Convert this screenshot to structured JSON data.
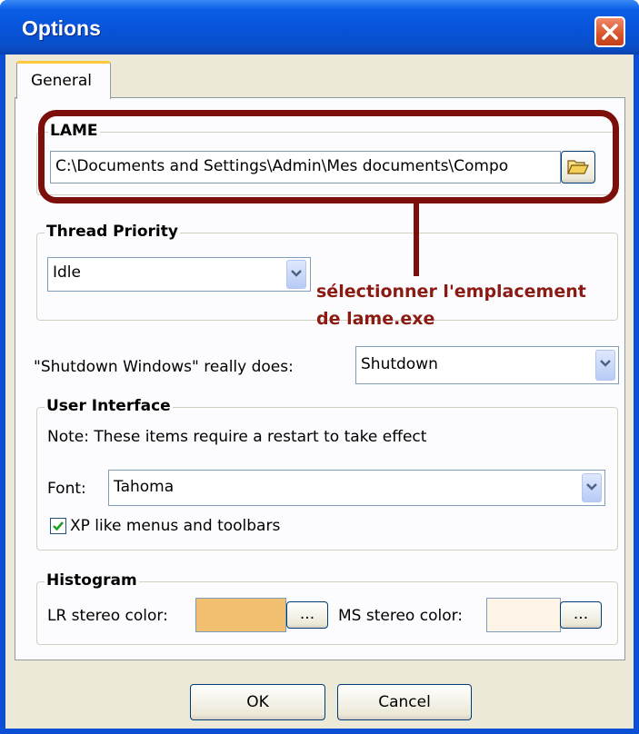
{
  "window": {
    "title": "Options"
  },
  "tabs": [
    {
      "label": "General"
    }
  ],
  "lame": {
    "group_label": "LAME",
    "path_value": "C:\\Documents and Settings\\Admin\\Mes documents\\Compo"
  },
  "thread_priority": {
    "group_label": "Thread Priority",
    "selected": "Idle"
  },
  "shutdown": {
    "label": "\"Shutdown Windows\" really does:",
    "selected": "Shutdown"
  },
  "user_interface": {
    "group_label": "User Interface",
    "note": "Note: These items require a restart to take effect",
    "font_label": "Font:",
    "font_selected": "Tahoma",
    "xp_menus_label": "XP like menus and toolbars",
    "xp_menus_checked": true
  },
  "histogram": {
    "group_label": "Histogram",
    "lr_label": "LR stereo color:",
    "lr_color": "#f0c070",
    "ms_label": "MS stereo color:",
    "ms_color": "#fdf3e6",
    "browse_label": "..."
  },
  "annotation": {
    "line1": "sélectionner l'emplacement",
    "line2": "de lame.exe"
  },
  "buttons": {
    "ok": "OK",
    "cancel": "Cancel"
  },
  "colors": {
    "annotation": "#8b1a12",
    "highlight": "#7d0f0a",
    "accent": "#0a4fd4"
  }
}
